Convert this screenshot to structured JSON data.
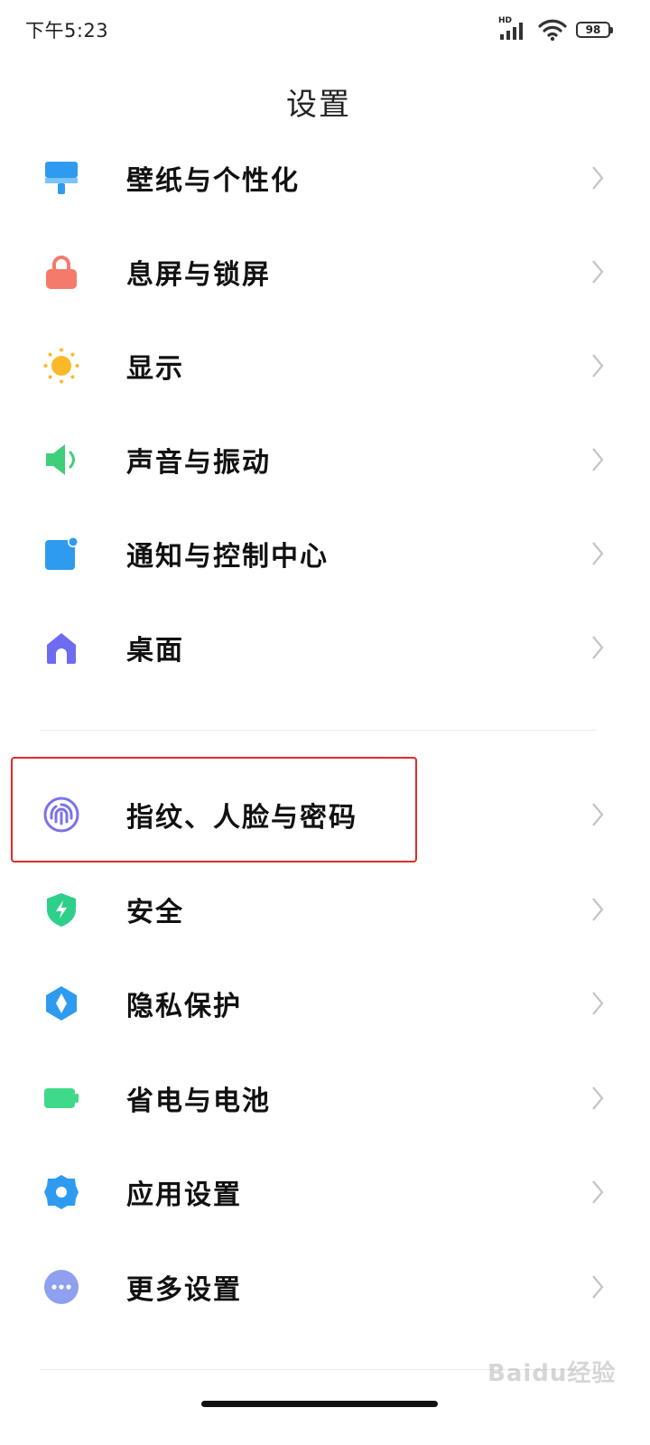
{
  "status_bar": {
    "time": "下午5:23",
    "network_badge": "HD",
    "battery_level": "98",
    "icons": [
      "signal-icon",
      "wifi-icon",
      "battery-icon"
    ]
  },
  "header": {
    "title": "设置"
  },
  "settings_groups": [
    {
      "items": [
        {
          "label": "壁纸与个性化",
          "icon": "paintbrush-icon",
          "color": "#2e9bf0"
        },
        {
          "label": "息屏与锁屏",
          "icon": "lock-icon",
          "color": "#f47a6b"
        },
        {
          "label": "显示",
          "icon": "sun-icon",
          "color": "#f9b929"
        },
        {
          "label": "声音与振动",
          "icon": "speaker-icon",
          "color": "#3fcf7a"
        },
        {
          "label": "通知与控制中心",
          "icon": "notification-icon",
          "color": "#2e9bf0"
        },
        {
          "label": "桌面",
          "icon": "home-icon",
          "color": "#6d6cf0"
        }
      ]
    },
    {
      "items": [
        {
          "label": "指纹、人脸与密码",
          "icon": "fingerprint-icon",
          "color": "#7a72e8"
        },
        {
          "label": "安全",
          "icon": "shield-icon",
          "color": "#2ecf8a"
        },
        {
          "label": "隐私保护",
          "icon": "privacy-icon",
          "color": "#2e9bf0"
        },
        {
          "label": "省电与电池",
          "icon": "battery-icon",
          "color": "#3fd98a"
        },
        {
          "label": "应用设置",
          "icon": "gear-icon",
          "color": "#2e9bf0"
        },
        {
          "label": "更多设置",
          "icon": "more-icon",
          "color": "#8fa0f0"
        }
      ]
    }
  ],
  "watermark": {
    "text": "Baidu经验"
  },
  "colors": {
    "highlight": "#e02a2a",
    "chevron": "#c4c4c4"
  }
}
